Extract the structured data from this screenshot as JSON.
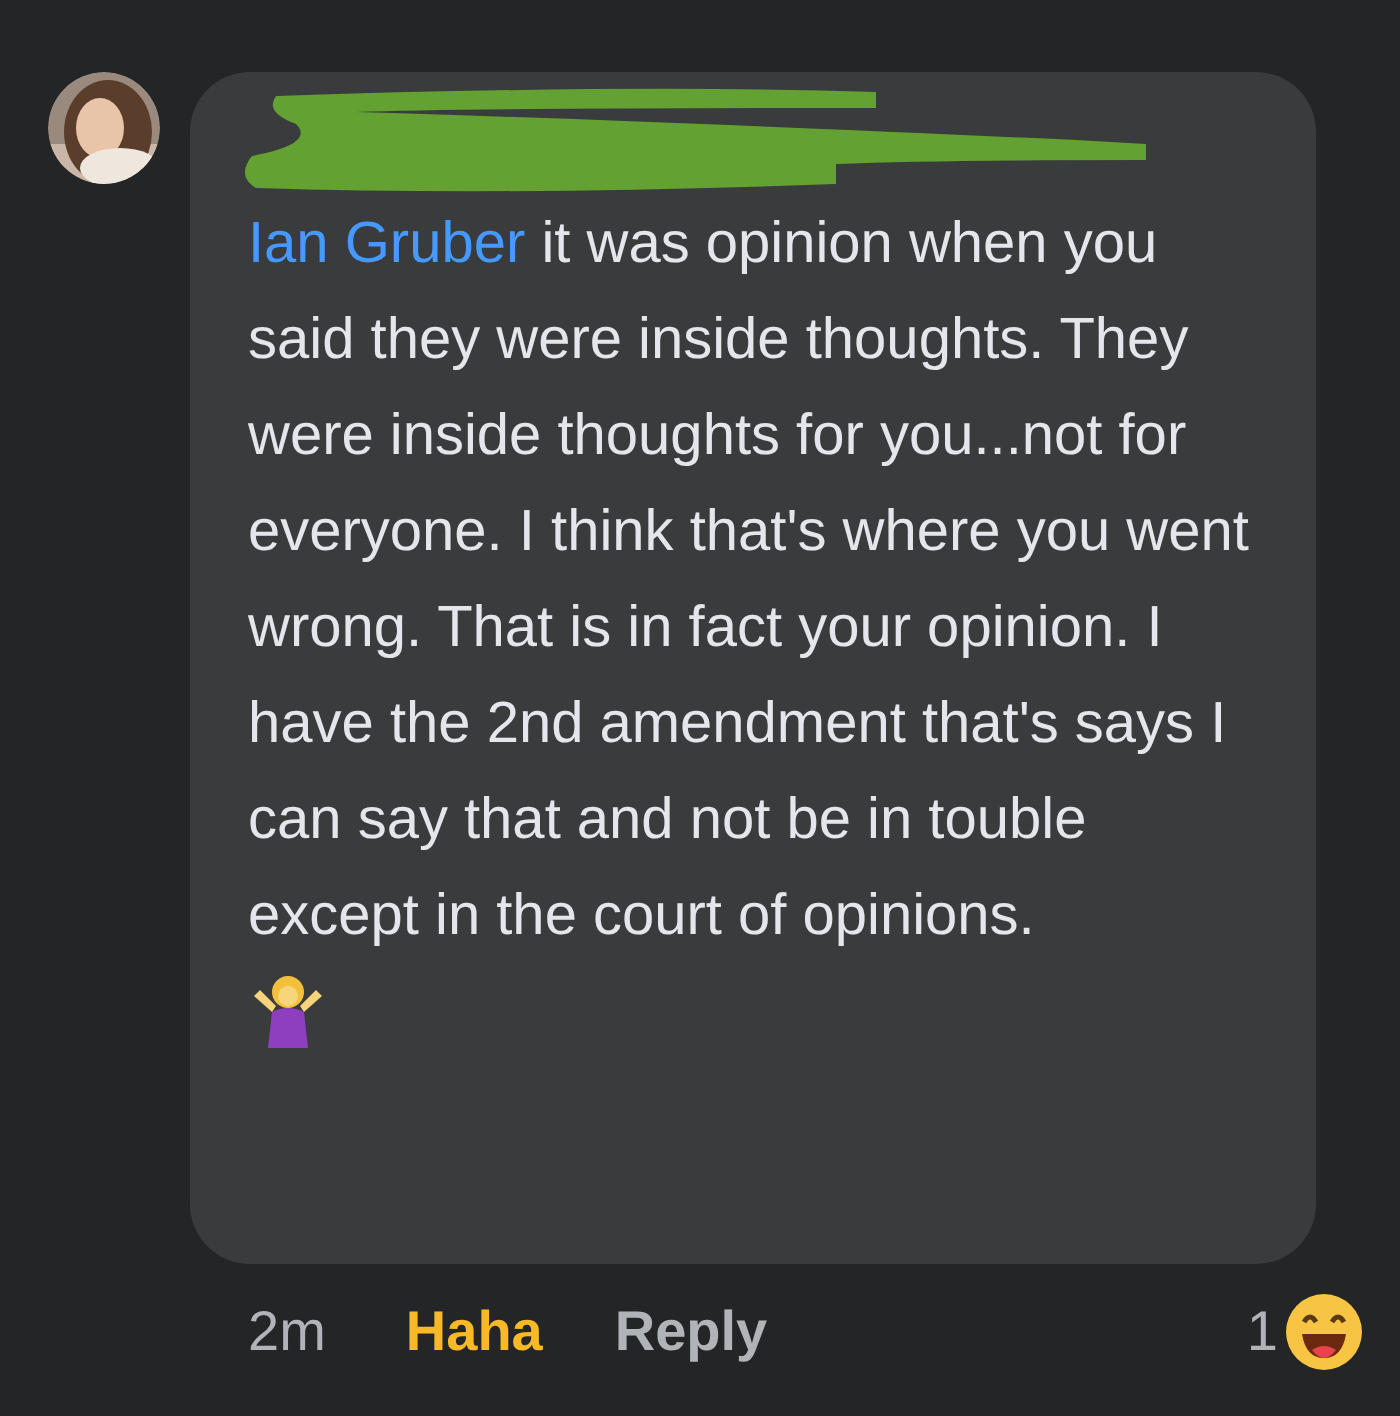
{
  "comment": {
    "mention": "Ian Gruber",
    "text": " it was opinion when you said they were inside thoughts. They were inside thoughts for you...not for everyone. I think that's where you went wrong. That is in fact your opinion. I have the 2nd amendment that's says I can say that and not be in touble except in the court of opinions."
  },
  "actions": {
    "time": "2m",
    "reaction": {
      "label": "Haha",
      "selected": true
    },
    "reply": "Reply",
    "reaction_count": "1"
  }
}
